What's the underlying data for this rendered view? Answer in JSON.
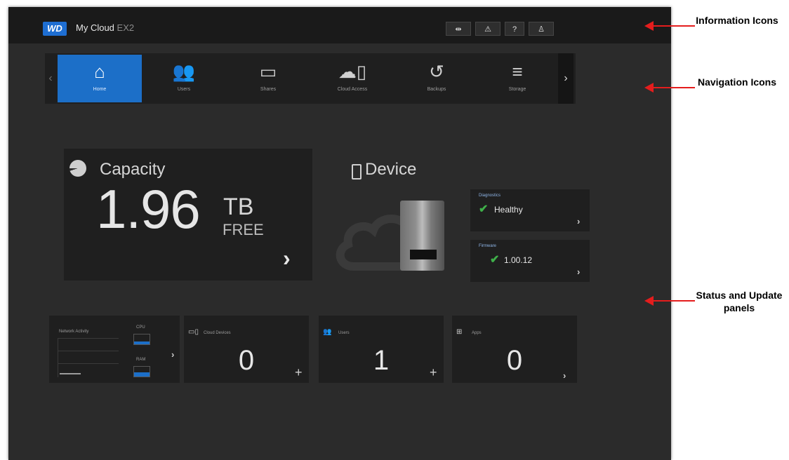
{
  "topbar": {
    "logo": "WD",
    "title": "My Cloud",
    "model": "EX2",
    "info_icons": [
      "usb-icon",
      "bell-icon",
      "help-icon",
      "user-icon"
    ],
    "info_glyphs": [
      "⇹",
      "⚠",
      "?",
      "♙"
    ]
  },
  "nav": {
    "items": [
      {
        "label": "Home",
        "icon": "home-icon",
        "glyph": "⌂"
      },
      {
        "label": "Users",
        "icon": "users-icon",
        "glyph": "👥"
      },
      {
        "label": "Shares",
        "icon": "folder-icon",
        "glyph": "▭"
      },
      {
        "label": "Cloud Access",
        "icon": "cloud-access-icon",
        "glyph": "☁▯"
      },
      {
        "label": "Backups",
        "icon": "backup-icon",
        "glyph": "↺"
      },
      {
        "label": "Storage",
        "icon": "storage-icon",
        "glyph": "≡"
      }
    ],
    "left_arrow": "‹",
    "right_arrow": "›"
  },
  "capacity": {
    "title": "Capacity",
    "value": "1.96",
    "unit": "TB",
    "free_label": "FREE",
    "arrow": "›"
  },
  "device": {
    "title": "Device",
    "diagnostics": {
      "label": "Diagnostics",
      "value": "Healthy"
    },
    "firmware": {
      "label": "Firmware",
      "value": "1.00.12"
    }
  },
  "network": {
    "title": "Network Activity",
    "cpu_label": "CPU",
    "ram_label": "RAM",
    "cpu_level": 0.3,
    "ram_level": 0.45
  },
  "panels": [
    {
      "label": "Cloud Devices",
      "icon": "cloud-devices-icon",
      "value": "0",
      "action": "+"
    },
    {
      "label": "Users",
      "icon": "users-small-icon",
      "value": "1",
      "action": "+"
    },
    {
      "label": "Apps",
      "icon": "apps-icon",
      "value": "0",
      "action": "›"
    }
  ],
  "callouts": {
    "info": "Information Icons",
    "nav": "Navigation Icons",
    "status": "Status and Update panels"
  },
  "colors": {
    "accent": "#1c6fc8",
    "ok": "#3fb04a",
    "callout_arrow": "#e41d1d"
  }
}
